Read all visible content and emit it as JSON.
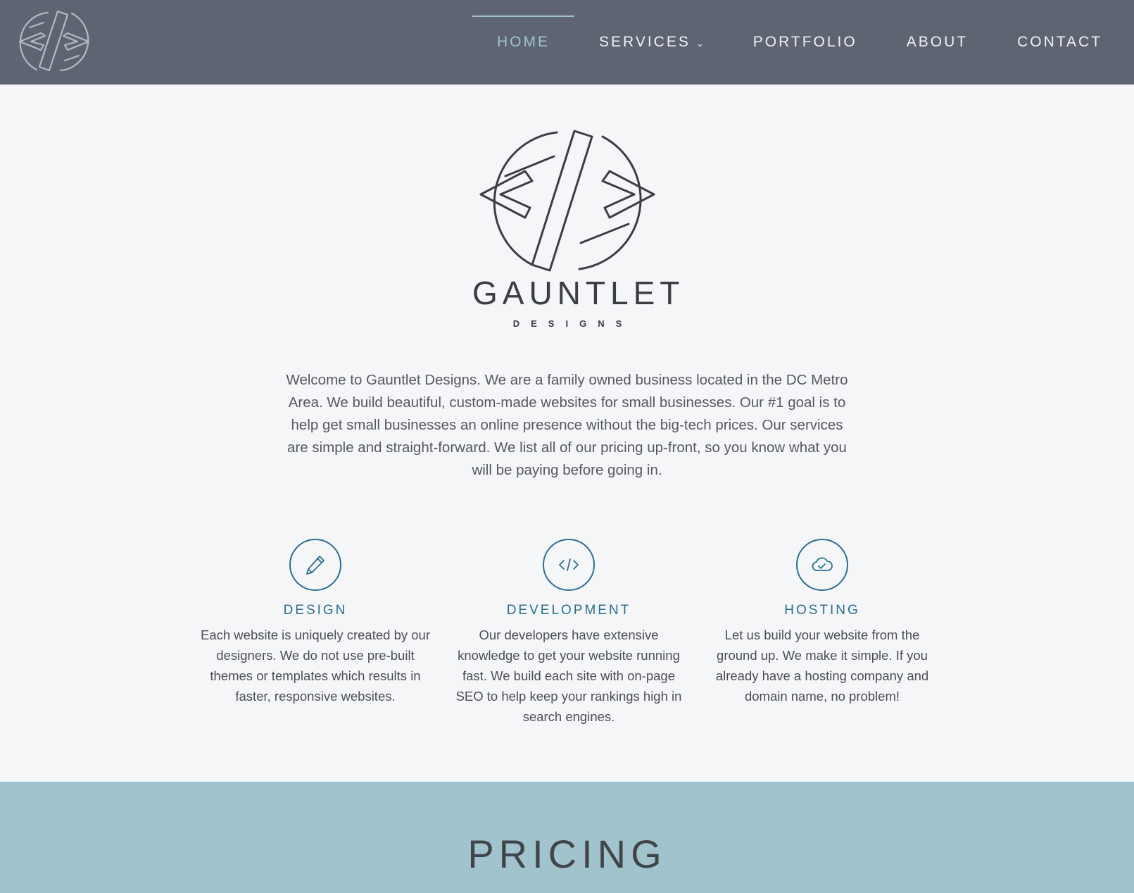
{
  "nav": {
    "logo_icon": "gauntlet-logo-icon",
    "items": [
      {
        "label": "HOME",
        "active": true
      },
      {
        "label": "SERVICES",
        "has_dropdown": true,
        "dropdown_icon": "chevron-down-icon"
      },
      {
        "label": "PORTFOLIO"
      },
      {
        "label": "ABOUT"
      },
      {
        "label": "CONTACT"
      }
    ],
    "colors": {
      "background": "#5f6473",
      "text": "#f1f2f4",
      "active": "#9fc2cc"
    }
  },
  "hero": {
    "brand_name": "GAUNTLET",
    "brand_sub": "DESIGNS",
    "intro": "Welcome to Gauntlet Designs. We are a family owned business located in the DC Metro Area. We build beautiful, custom-made websites for small businesses. Our #1 goal is to help get small businesses an online presence without the big-tech prices. Our services are simple and straight-forward. We list all of our pricing up-front, so you know what you will be paying before going in."
  },
  "features": [
    {
      "icon": "pencil-icon",
      "title": "DESIGN",
      "text": "Each website is uniquely created by our designers. We do not use pre-built themes or templates which results in faster, responsive websites."
    },
    {
      "icon": "code-icon",
      "title": "DEVELOPMENT",
      "text": "Our developers have extensive knowledge to get your website running fast. We build each site with on-page SEO to help keep your rankings high in search engines."
    },
    {
      "icon": "cloud-check-icon",
      "title": "HOSTING",
      "text": "Let us build your website from the ground up. We make it simple. If you already have a hosting company and domain name, no problem!"
    }
  ],
  "pricing": {
    "title": "PRICING",
    "background": "#a0c3cd"
  },
  "accent_color": "#2e6f8e"
}
